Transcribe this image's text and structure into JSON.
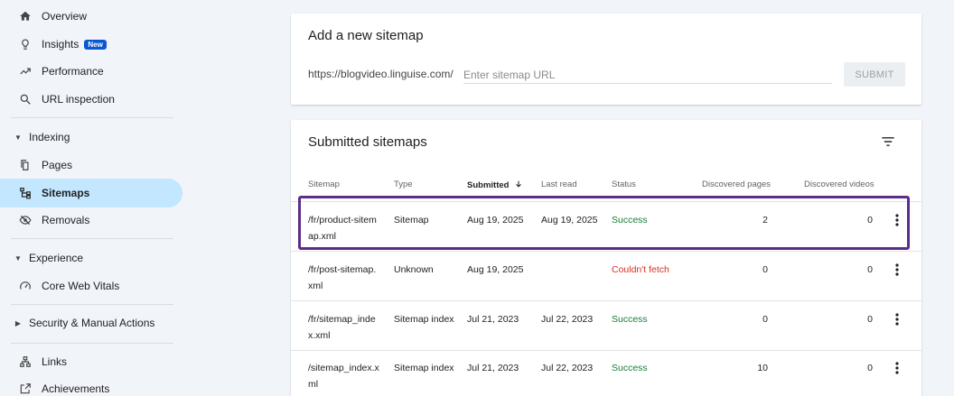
{
  "sidebar": {
    "items": [
      {
        "label": "Overview",
        "icon": "home-icon"
      },
      {
        "label": "Insights",
        "badge": "New",
        "icon": "lightbulb-icon"
      },
      {
        "label": "Performance",
        "icon": "trending-up-icon"
      },
      {
        "label": "URL inspection",
        "icon": "search-icon"
      }
    ],
    "indexing": {
      "header": "Indexing",
      "items": [
        {
          "label": "Pages",
          "icon": "pages-icon"
        },
        {
          "label": "Sitemaps",
          "icon": "sitemap-icon",
          "active": true
        },
        {
          "label": "Removals",
          "icon": "visibility-off-icon"
        }
      ]
    },
    "experience": {
      "header": "Experience",
      "items": [
        {
          "label": "Core Web Vitals",
          "icon": "speed-icon"
        }
      ]
    },
    "security": {
      "header": "Security & Manual Actions"
    },
    "bottom": [
      {
        "label": "Links",
        "icon": "links-icon"
      },
      {
        "label": "Achievements",
        "icon": "achievements-icon"
      }
    ]
  },
  "add_sitemap": {
    "title": "Add a new sitemap",
    "url_prefix": "https://blogvideo.linguise.com/",
    "placeholder": "Enter sitemap URL",
    "value": "",
    "submit_label": "SUBMIT"
  },
  "submitted": {
    "title": "Submitted sitemaps",
    "columns": {
      "sitemap": "Sitemap",
      "type": "Type",
      "submitted": "Submitted",
      "last_read": "Last read",
      "status": "Status",
      "pages": "Discovered pages",
      "videos": "Discovered videos"
    },
    "rows": [
      {
        "sitemap_l1": "/fr/product-sitem",
        "sitemap_l2": "ap.xml",
        "type": "Sitemap",
        "submitted": "Aug 19, 2025",
        "last_read": "Aug 19, 2025",
        "status": "Success",
        "pages": "2",
        "videos": "0"
      },
      {
        "sitemap_l1": "/fr/post-sitemap.",
        "sitemap_l2": "xml",
        "type": "Unknown",
        "submitted": "Aug 19, 2025",
        "last_read": "",
        "status": "Couldn't fetch",
        "pages": "0",
        "videos": "0"
      },
      {
        "sitemap_l1": "/fr/sitemap_inde",
        "sitemap_l2": "x.xml",
        "type": "Sitemap index",
        "submitted": "Jul 21, 2023",
        "last_read": "Jul 22, 2023",
        "status": "Success",
        "pages": "0",
        "videos": "0"
      },
      {
        "sitemap_l1": "/sitemap_index.x",
        "sitemap_l2": "ml",
        "type": "Sitemap index",
        "submitted": "Jul 21, 2023",
        "last_read": "Jul 22, 2023",
        "status": "Success",
        "pages": "10",
        "videos": "0"
      }
    ]
  },
  "colors": {
    "accent": "#0b57d0",
    "active_bg": "#c2e7ff",
    "success": "#188038",
    "error": "#d93025",
    "highlight_border": "#5c2d8c"
  }
}
